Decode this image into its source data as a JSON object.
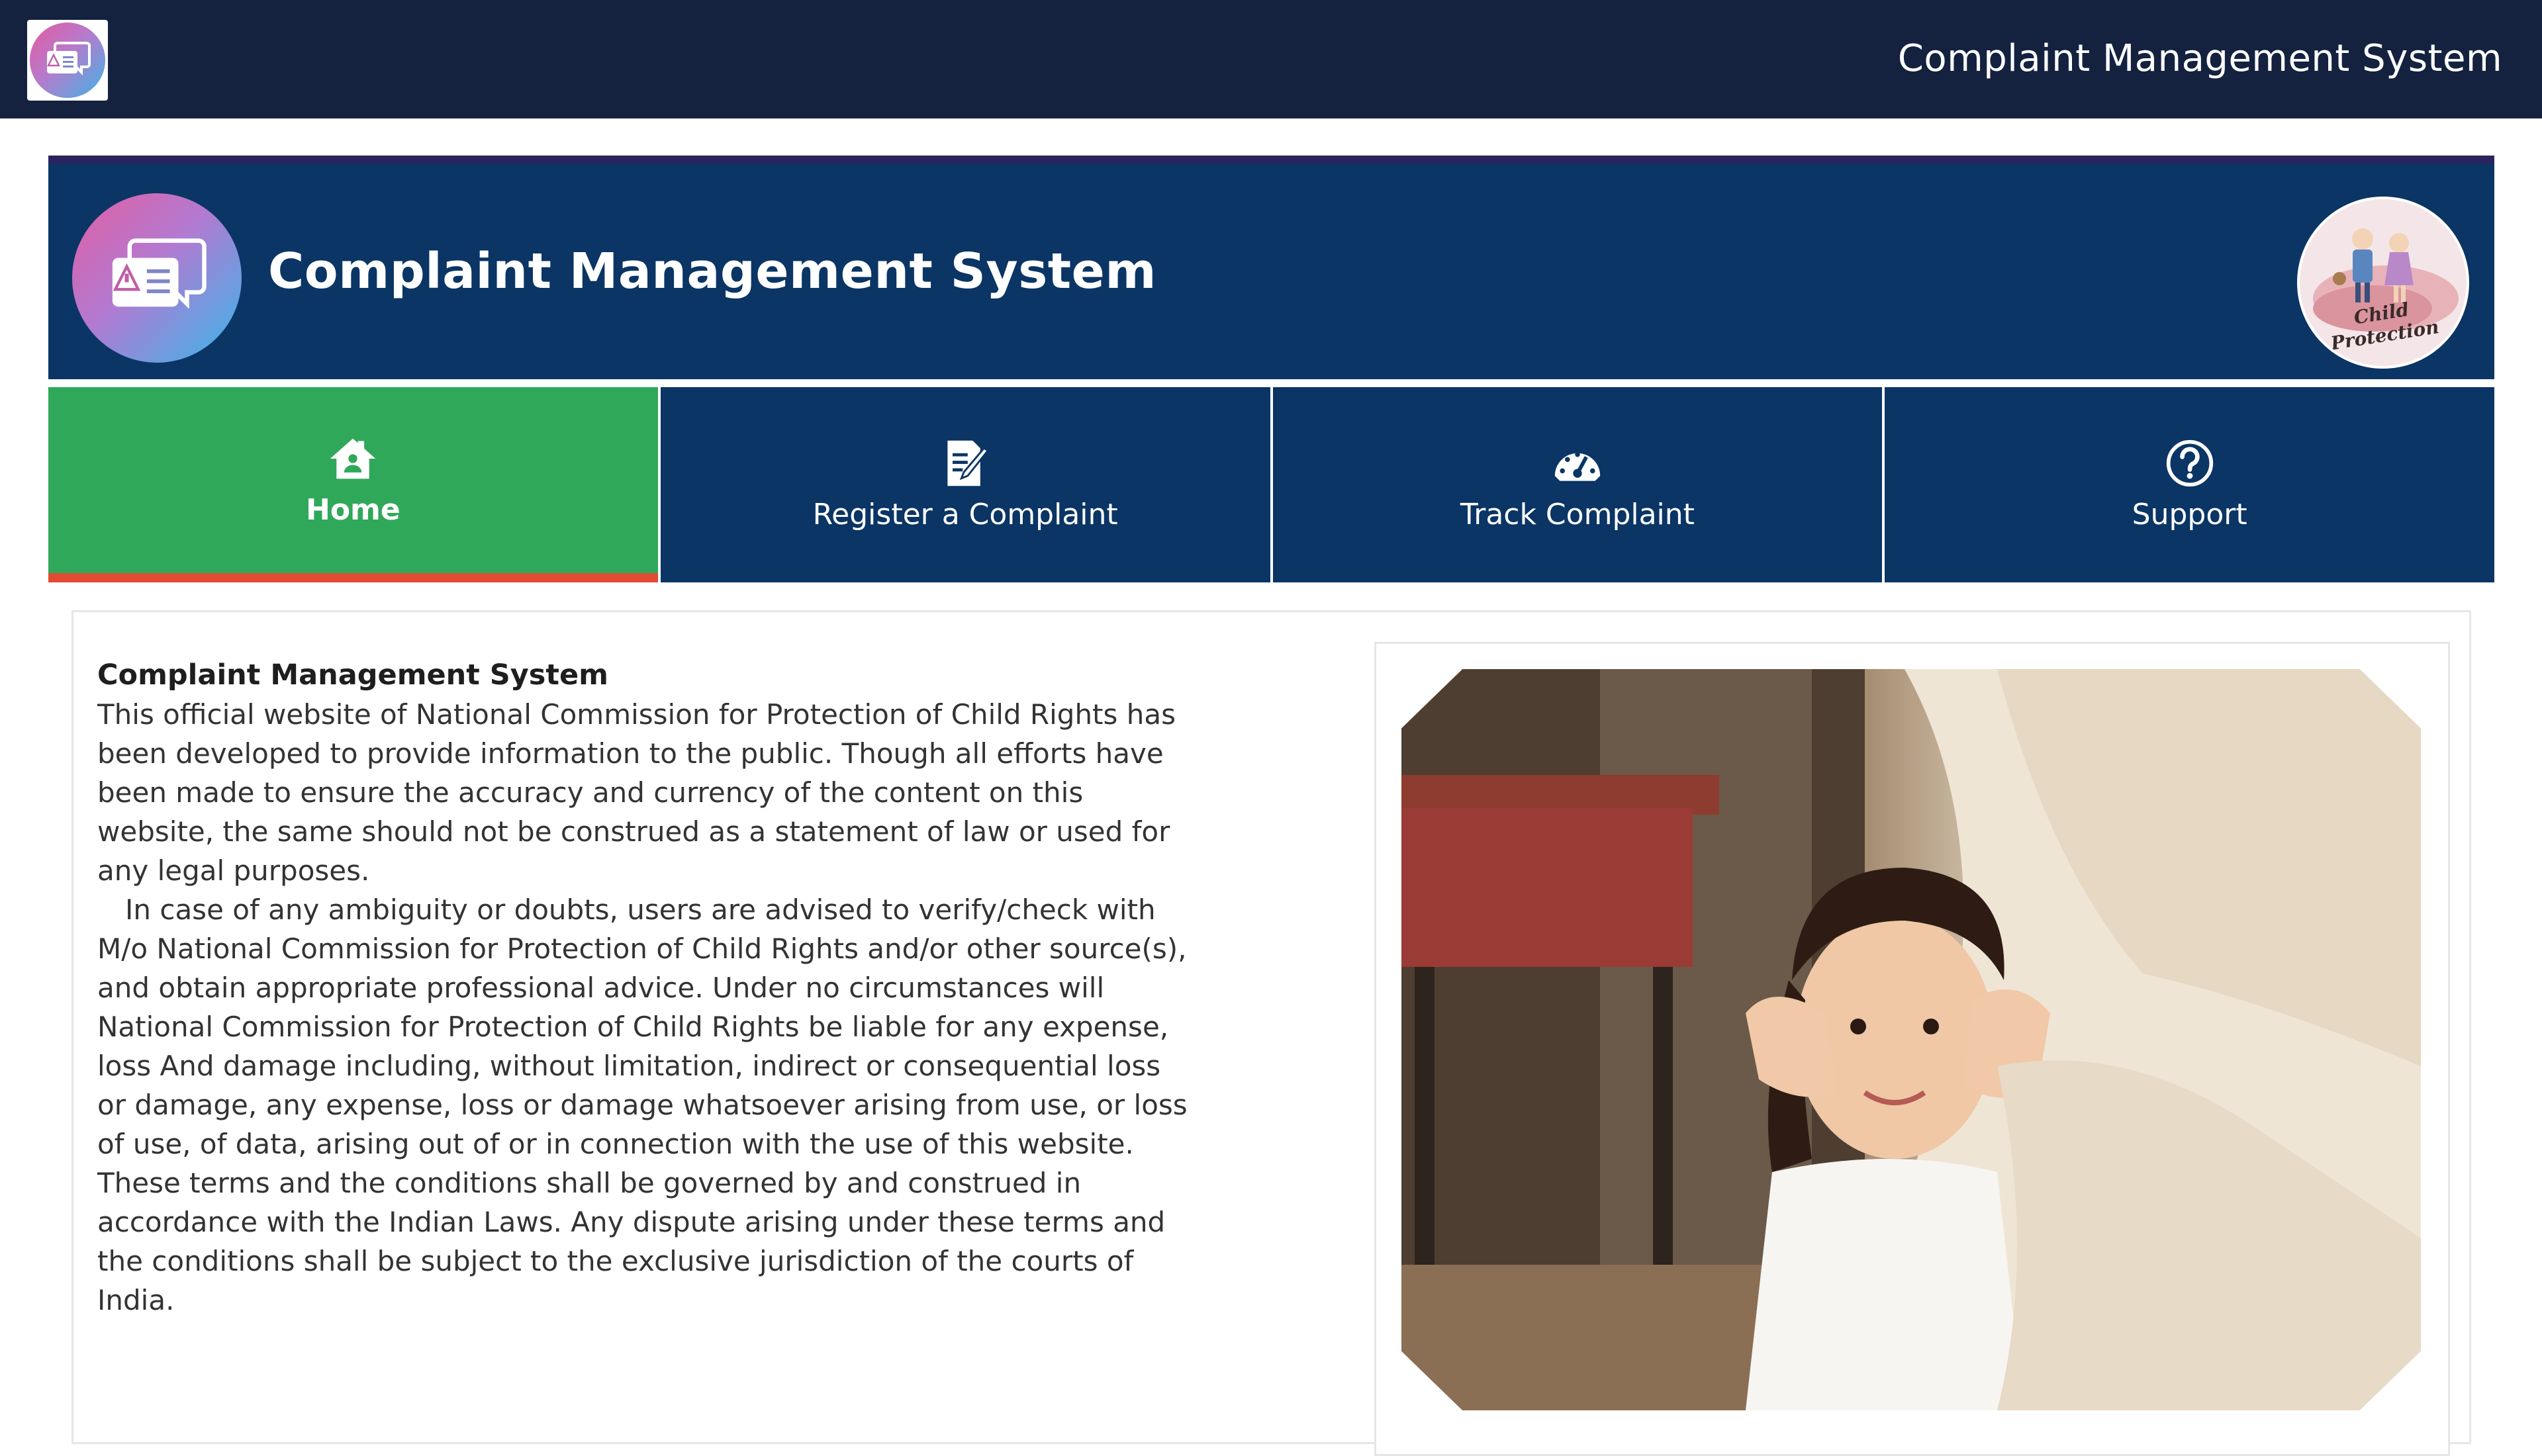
{
  "topbar": {
    "title": "Complaint Management System",
    "logo_icon": "chat-warning-icon"
  },
  "banner": {
    "title": "Complaint Management System",
    "logo_icon": "chat-warning-icon",
    "emblem_text": "Child Protection"
  },
  "nav": {
    "items": [
      {
        "label": "Home",
        "icon": "home-icon",
        "active": true
      },
      {
        "label": "Register a Complaint",
        "icon": "edit-document-icon",
        "active": false
      },
      {
        "label": "Track Complaint",
        "icon": "speedometer-icon",
        "active": false
      },
      {
        "label": "Support",
        "icon": "question-circle-icon",
        "active": false
      }
    ]
  },
  "content": {
    "heading": "Complaint Management System",
    "paragraph1": "This official website of National Commission for Protection of Child Rights has been developed to provide information to the public. Though all efforts have been made to ensure the accuracy and currency of the content on this website, the same should not be construed as a statement of law or used for any legal purposes.",
    "paragraph2": "In case of any ambiguity or doubts, users are advised to verify/check with M/o National Commission for Protection of Child Rights and/or other source(s), and obtain appropriate professional advice.  Under no circumstances will National Commission for Protection of Child Rights be liable for any expense, loss   And damage including, without limitation, indirect or consequential loss or damage, any expense, loss or damage whatsoever arising from use, or loss of use, of data, arising out of or in connection with the use of this website.  These terms and the conditions shall be governed by and construed in accordance with the Indian Laws. Any dispute arising under these terms and the conditions shall be subject to the exclusive jurisdiction of the courts of India."
  },
  "colors": {
    "topbar": "#142240",
    "banner": "#0a3565",
    "nav_active": "#30a85a",
    "nav_active_underline": "#e34a33",
    "nav_default": "#0a3565"
  }
}
